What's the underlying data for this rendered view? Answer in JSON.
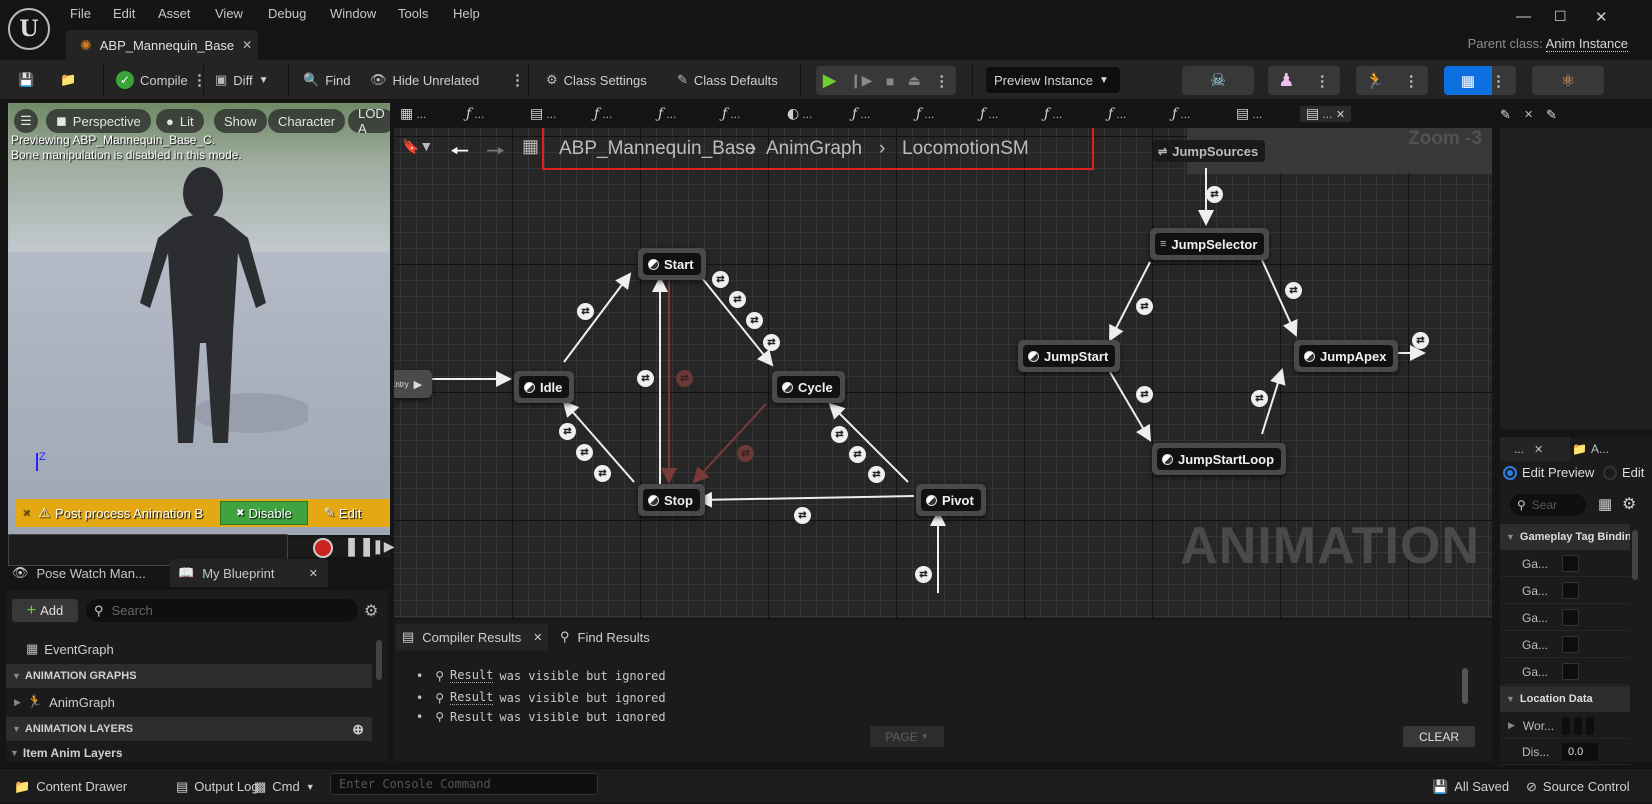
{
  "app": {
    "logo": "U",
    "menu": [
      "File",
      "Edit",
      "Asset",
      "View",
      "Debug",
      "Window",
      "Tools",
      "Help"
    ],
    "doc_tab": "ABP_Mannequin_Base",
    "parent_class_label": "Parent class:",
    "parent_class_value": "Anim Instance"
  },
  "toolbar": {
    "compile": "Compile",
    "diff": "Diff",
    "find": "Find",
    "hide_unrelated": "Hide Unrelated",
    "class_settings": "Class Settings",
    "class_defaults": "Class Defaults",
    "preview_instance": "Preview Instance",
    "colors": {
      "play": "#6fcf2f",
      "active_mode": "#0e70e0"
    }
  },
  "viewport": {
    "pills": [
      "Perspective",
      "Lit",
      "Show",
      "Character",
      "LOD A"
    ],
    "message_line1": "Previewing ABP_Mannequin_Base_C.",
    "message_line2": "Bone manipulation is disabled in this mode.",
    "axis_label": "Z",
    "warning_text": "Post process Animation B",
    "disable_label": "Disable",
    "edit_label": "Edit"
  },
  "left_panel": {
    "tabs": [
      "Pose Watch Man...",
      "My Blueprint"
    ],
    "add_label": "Add",
    "search_placeholder": "Search",
    "tree": [
      {
        "label": "EventGraph",
        "type": "item"
      },
      {
        "label": "ANIMATION GRAPHS",
        "type": "header"
      },
      {
        "label": "AnimGraph",
        "type": "item"
      },
      {
        "label": "ANIMATION LAYERS",
        "type": "header"
      },
      {
        "label": "Item Anim Layers",
        "type": "subheader"
      }
    ]
  },
  "graph": {
    "tabs_glyphs": [
      "graph",
      "f",
      "sm",
      "f",
      "f",
      "f",
      "state",
      "f",
      "f",
      "f",
      "f",
      "f",
      "f",
      "sm",
      "sm"
    ],
    "breadcrumb": [
      "ABP_Mannequin_Base",
      "AnimGraph",
      "LocomotionSM"
    ],
    "zoom_label": "Zoom -3",
    "watermark": "ANIMATION",
    "entry_label": "Entry",
    "nodes": {
      "start": "Start",
      "idle": "Idle",
      "cycle": "Cycle",
      "stop": "Stop",
      "pivot": "Pivot",
      "jump_sources": "JumpSources",
      "jump_selector": "JumpSelector",
      "jump_start": "JumpStart",
      "jump_apex": "JumpApex",
      "jump_start_loop": "JumpStartLoop"
    }
  },
  "details": {
    "tabs": [
      "...",
      "A..."
    ],
    "edit_preview": "Edit Preview",
    "edit": "Edit",
    "search_placeholder": "Sear",
    "section_tag": "Gameplay Tag Bindin",
    "tag_rows": [
      "Ga...",
      "Ga...",
      "Ga...",
      "Ga...",
      "Ga..."
    ],
    "section_location": "Location Data",
    "loc_rows": [
      {
        "label": "Wor...",
        "value": ""
      },
      {
        "label": "Dis...",
        "value": "0.0"
      }
    ]
  },
  "compiler": {
    "tabs": [
      "Compiler Results",
      "Find Results"
    ],
    "lines": [
      {
        "link": "Result",
        "text": "was visible but ignored"
      },
      {
        "link": "Result",
        "text": "was visible but ignored"
      },
      {
        "link": "Result",
        "text": "was visible but ignored"
      }
    ],
    "page_label": "PAGE",
    "clear_label": "CLEAR"
  },
  "statusbar": {
    "content_drawer": "Content Drawer",
    "output_log": "Output Log",
    "cmd": "Cmd",
    "console_placeholder": "Enter Console Command",
    "all_saved": "All Saved",
    "source_control": "Source Control"
  }
}
